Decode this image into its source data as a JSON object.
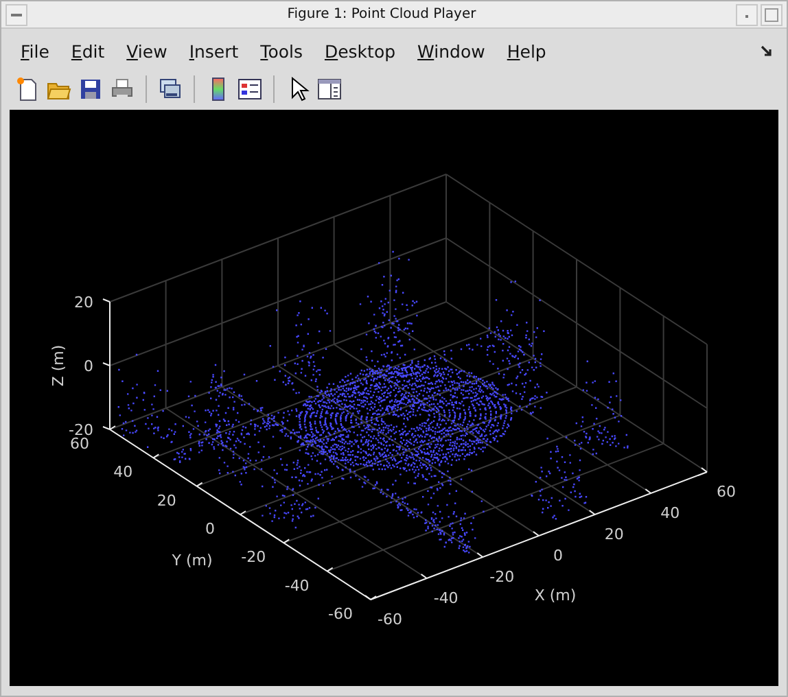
{
  "window": {
    "title": "Figure 1: Point Cloud Player"
  },
  "menu": [
    {
      "label": "File"
    },
    {
      "label": "Edit"
    },
    {
      "label": "View"
    },
    {
      "label": "Insert"
    },
    {
      "label": "Tools"
    },
    {
      "label": "Desktop"
    },
    {
      "label": "Window"
    },
    {
      "label": "Help"
    }
  ],
  "toolbar": [
    {
      "kind": "new"
    },
    {
      "kind": "open"
    },
    {
      "kind": "save"
    },
    {
      "kind": "print"
    },
    {
      "kind": "separator"
    },
    {
      "kind": "link"
    },
    {
      "kind": "separator"
    },
    {
      "kind": "colorbar"
    },
    {
      "kind": "legend"
    },
    {
      "kind": "separator"
    },
    {
      "kind": "pointer"
    },
    {
      "kind": "panel"
    }
  ],
  "axes": {
    "xlabel": "X (m)",
    "ylabel": "Y (m)",
    "zlabel": "Z (m)",
    "xticks": [
      "-60",
      "-40",
      "-20",
      "0",
      "20",
      "40",
      "60"
    ],
    "yticks": [
      "-60",
      "-40",
      "-20",
      "0",
      "20",
      "40",
      "60"
    ],
    "zticks": [
      "20",
      "0",
      "-20"
    ]
  }
}
